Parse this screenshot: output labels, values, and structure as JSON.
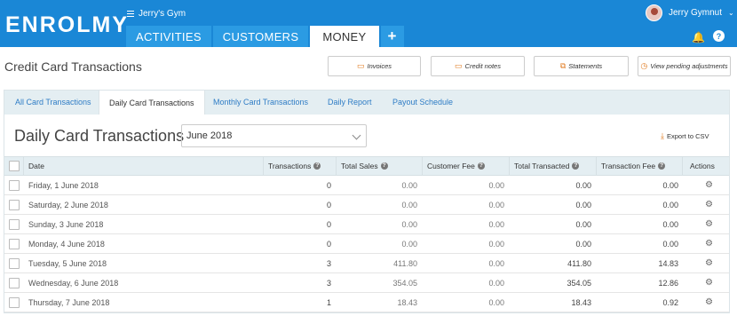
{
  "app": {
    "logo": "ENROLMY",
    "gym_name": "Jerry's Gym",
    "user_name": "Jerry Gymnut",
    "nav_tabs": [
      {
        "label": "ACTIVITIES"
      },
      {
        "label": "CUSTOMERS"
      },
      {
        "label": "MONEY"
      }
    ],
    "add_label": "+",
    "help_label": "?"
  },
  "page": {
    "title": "Credit Card Transactions",
    "buttons": {
      "invoices": "Invoices",
      "credit_notes": "Credit notes",
      "statements": "Statements",
      "pending": "View pending adjustments"
    }
  },
  "subtabs": [
    {
      "label": "All Card Transactions"
    },
    {
      "label": "Daily Card Transactions"
    },
    {
      "label": "Monthly Card Transactions"
    },
    {
      "label": "Daily Report"
    },
    {
      "label": "Payout Schedule"
    }
  ],
  "content": {
    "title": "Daily Card Transactions",
    "month_selected": "June 2018",
    "export_label": "Export to CSV"
  },
  "table": {
    "columns": {
      "date": "Date",
      "transactions": "Transactions",
      "total_sales": "Total Sales",
      "customer_fee": "Customer Fee",
      "total_transacted": "Total Transacted",
      "transaction_fee": "Transaction Fee",
      "actions": "Actions"
    },
    "rows": [
      {
        "date": "Friday, 1 June 2018",
        "transactions": "0",
        "total_sales": "0.00",
        "customer_fee": "0.00",
        "total_transacted": "0.00",
        "transaction_fee": "0.00"
      },
      {
        "date": "Saturday, 2 June 2018",
        "transactions": "0",
        "total_sales": "0.00",
        "customer_fee": "0.00",
        "total_transacted": "0.00",
        "transaction_fee": "0.00"
      },
      {
        "date": "Sunday, 3 June 2018",
        "transactions": "0",
        "total_sales": "0.00",
        "customer_fee": "0.00",
        "total_transacted": "0.00",
        "transaction_fee": "0.00"
      },
      {
        "date": "Monday, 4 June 2018",
        "transactions": "0",
        "total_sales": "0.00",
        "customer_fee": "0.00",
        "total_transacted": "0.00",
        "transaction_fee": "0.00"
      },
      {
        "date": "Tuesday, 5 June 2018",
        "transactions": "3",
        "total_sales": "411.80",
        "customer_fee": "0.00",
        "total_transacted": "411.80",
        "transaction_fee": "14.83"
      },
      {
        "date": "Wednesday, 6 June 2018",
        "transactions": "3",
        "total_sales": "354.05",
        "customer_fee": "0.00",
        "total_transacted": "354.05",
        "transaction_fee": "12.86"
      },
      {
        "date": "Thursday, 7 June 2018",
        "transactions": "1",
        "total_sales": "18.43",
        "customer_fee": "0.00",
        "total_transacted": "18.43",
        "transaction_fee": "0.92"
      }
    ]
  },
  "colors": {
    "brand_blue": "#1a87d6",
    "accent_orange": "#e07a1f",
    "link_blue": "#2e7cc5"
  }
}
